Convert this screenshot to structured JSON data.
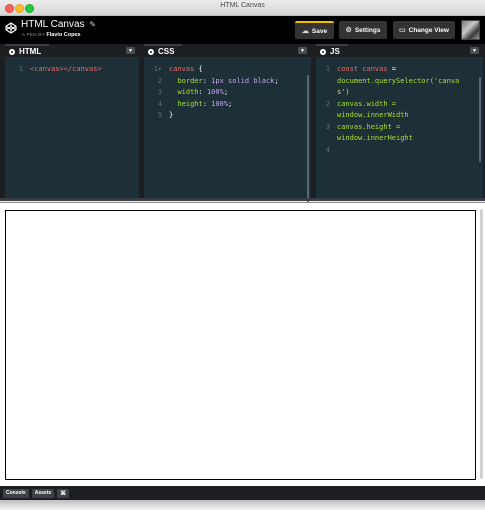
{
  "window": {
    "title": "HTML Canvas"
  },
  "header": {
    "pen_title": "HTML Canvas",
    "pen_by_label": "A PEN BY",
    "author": "Flavio Copes",
    "buttons": {
      "save": "Save",
      "settings": "Settings",
      "change_view": "Change View"
    },
    "accent_color": "#f0c000"
  },
  "editors": {
    "html": {
      "label": "HTML",
      "lines": [
        {
          "num": "1",
          "code": "<canvas></canvas>"
        }
      ]
    },
    "css": {
      "label": "CSS",
      "lines": [
        {
          "num": "1",
          "fold": "▾",
          "selector": "canvas",
          "brace": " {"
        },
        {
          "num": "2",
          "prop": "border",
          "value": "1px solid black"
        },
        {
          "num": "3",
          "prop": "width",
          "value": "100%"
        },
        {
          "num": "4",
          "prop": "height",
          "value": "100%"
        },
        {
          "num": "5",
          "close": "}"
        }
      ]
    },
    "js": {
      "label": "JS",
      "lines": [
        {
          "num": "1",
          "parts": [
            "const",
            " canvas",
            " =",
            "document.querySelector('canva",
            "s')"
          ]
        },
        {
          "num": "2",
          "parts": [
            "canvas.width =",
            "window.innerWidth"
          ]
        },
        {
          "num": "3",
          "parts": [
            "canvas.height =",
            "window.innerHeight"
          ]
        },
        {
          "num": "4",
          "parts": []
        }
      ]
    }
  },
  "footer": {
    "console": "Console",
    "assets": "Assets",
    "shortcuts": "⌘"
  }
}
